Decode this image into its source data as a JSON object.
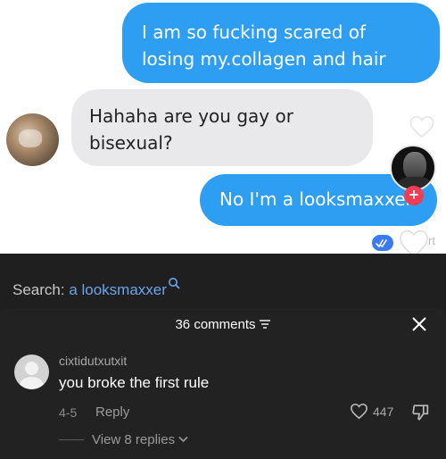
{
  "chat": {
    "messages": [
      {
        "from": "me",
        "text": "I am so fucking scared of losing my.collagen and hair"
      },
      {
        "from": "them",
        "text": "Hahaha are you gay or bisexual?"
      },
      {
        "from": "me",
        "text": "No I'm a looksmaxxer"
      }
    ],
    "overlay_partial_text": "rt"
  },
  "search": {
    "prefix": "Search: ",
    "query": "a looksmaxxer"
  },
  "comments": {
    "title": "36 comments",
    "items": [
      {
        "username": "cixtidutxutxit",
        "text": "you broke the first rule",
        "date": "4-5",
        "reply_label": "Reply",
        "likes": "447",
        "view_replies_label": "View 8 replies"
      }
    ]
  },
  "colors": {
    "outgoing_bubble": "#2e9ef2",
    "incoming_bubble": "#e9e9eb",
    "link": "#6aa5ee",
    "panel_bg": "#222222",
    "follow_badge": "#f23b54"
  },
  "icons": [
    "heart-outline-icon",
    "plus-icon",
    "double-check-icon",
    "search-icon",
    "filter-icon",
    "close-icon",
    "heart-icon",
    "dislike-icon",
    "chevron-down-icon"
  ]
}
